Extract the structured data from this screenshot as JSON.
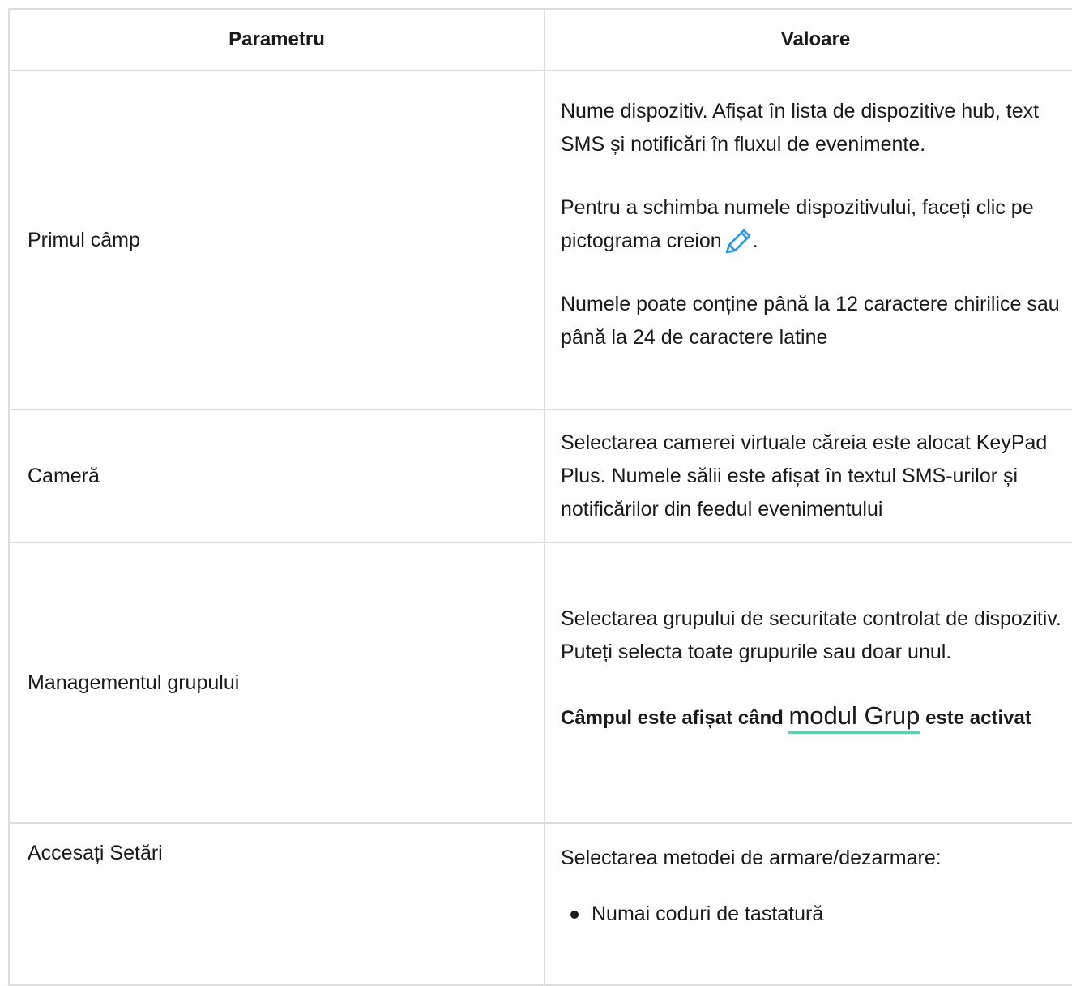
{
  "table": {
    "header": {
      "param": "Parametru",
      "value": "Valoare"
    },
    "row1": {
      "param": "Primul câmp",
      "p1": "Nume dispozitiv. Afișat în lista de dispozitive hub, text SMS și notificări în fluxul de evenimente.",
      "p2": "Pentru a schimba numele dispozitivului, faceți clic pe pictograma creion",
      "p2_end": ".",
      "p3": "Numele poate conține până la 12 caractere chirilice sau până la 24 de caractere latine"
    },
    "row2": {
      "param": "Cameră",
      "p1": "Selectarea camerei virtuale căreia este alocat KeyPad Plus. Numele sălii este afișat în textul SMS-urilor și notificărilor din feedul evenimentului"
    },
    "row3": {
      "param": "Managementul grupului",
      "p1": "Selectarea grupului de securitate controlat de dispozitiv. Puteți selecta toate grupurile sau doar unul.",
      "note_before": "Câmpul este afișat când ",
      "note_link": "modul Grup",
      "note_after": " este activat"
    },
    "row4": {
      "param": "Accesați Setări",
      "p1": "Selectarea metodei de armare/dezarmare:",
      "bullet1": "Numai coduri de tastatură"
    }
  },
  "colors": {
    "border": "#dcdcdc",
    "link_underline": "#58d6a9",
    "pencil": "#2196f3"
  },
  "icons": {
    "pencil": "pencil-icon",
    "bullet": "bullet-icon"
  }
}
